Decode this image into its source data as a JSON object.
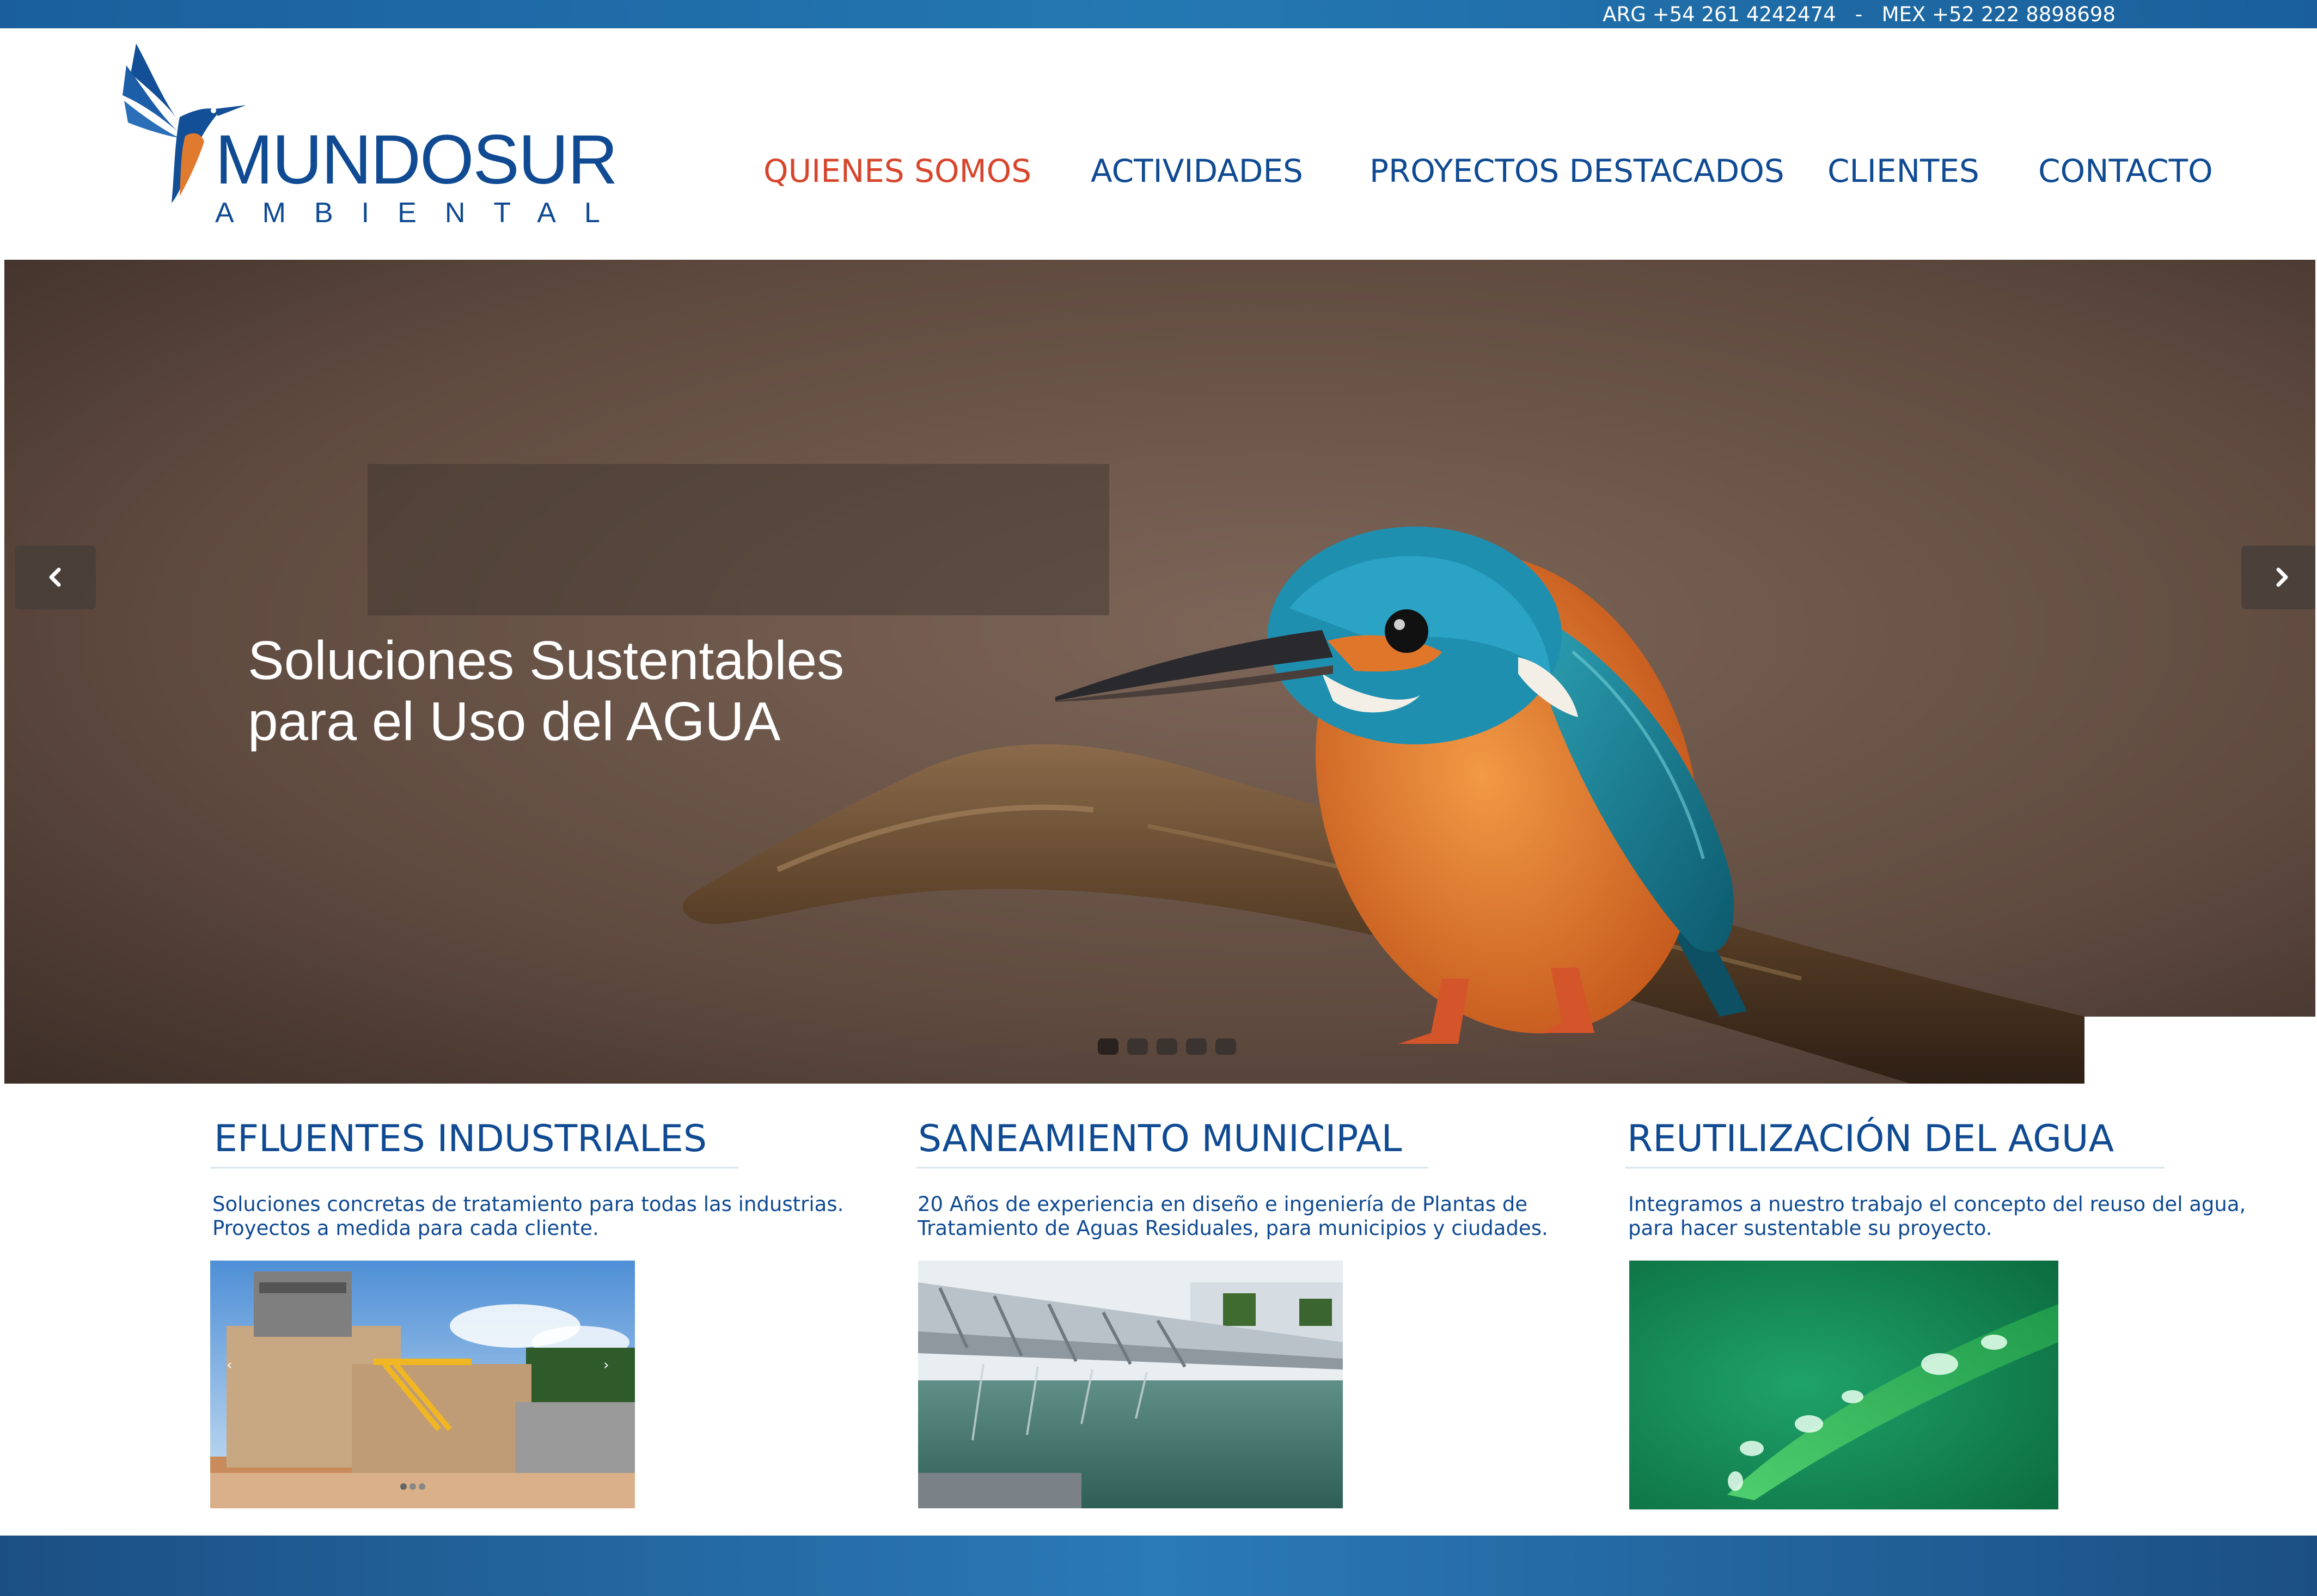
{
  "topbar": {
    "contact": "ARG +54 261 4242474   -   MEX +52 222 8898698"
  },
  "logo": {
    "name": "MUNDOSUR",
    "sub": "AMBIENTAL"
  },
  "nav": [
    {
      "label": "QUIENES SOMOS",
      "active": true
    },
    {
      "label": "ACTIVIDADES"
    },
    {
      "label": "PROYECTOS DESTACADOS"
    },
    {
      "label": "CLIENTES"
    },
    {
      "label": "CONTACTO"
    }
  ],
  "hero": {
    "title_line1": "Soluciones Sustentables",
    "title_line2": "para el Uso del AGUA",
    "slide_count": 5,
    "active_slide": 1
  },
  "columns": [
    {
      "title": "EFLUENTES INDUSTRIALES",
      "text_line1": "Soluciones concretas de tratamiento para todas las industrias.",
      "text_line2": "Proyectos a medida para cada cliente."
    },
    {
      "title": "SANEAMIENTO MUNICIPAL",
      "text_line1": "20 Años de experiencia en diseño e ingeniería de Plantas de",
      "text_line2": "Tratamiento de Aguas Residuales, para municipios y ciudades."
    },
    {
      "title": "REUTILIZACIÓN DEL AGUA",
      "text_line1": "Integramos a nuestro trabajo el concepto del reuso del agua,",
      "text_line2": "para hacer sustentable su proyecto."
    }
  ],
  "colors": {
    "brand_blue": "#0f4a92",
    "nav_active": "#d6462c",
    "bar_blue": "#2478b2"
  }
}
